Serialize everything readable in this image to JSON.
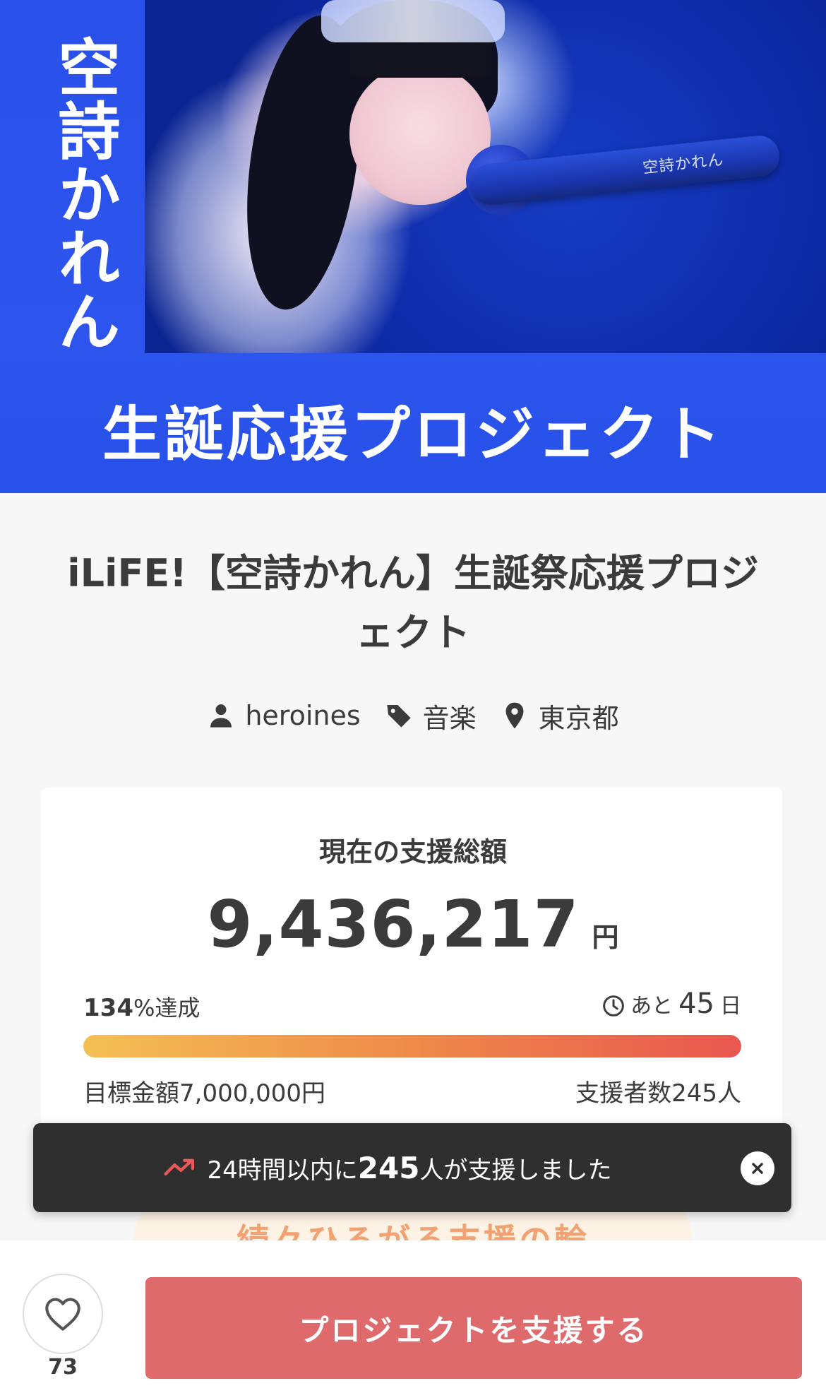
{
  "hero": {
    "vertical_title": "空詩かれん",
    "mic_label": "空詩かれん",
    "banner_text": "生誕応援プロジェクト"
  },
  "project": {
    "title": "iLiFE!【空詩かれん】生誕祭応援プロジェクト",
    "owner": "heroines",
    "category": "音楽",
    "location": "東京都"
  },
  "funding": {
    "label": "現在の支援総額",
    "amount": "9,436,217",
    "currency": "円",
    "percent_value": "134",
    "percent_suffix": "%達成",
    "progress_fraction": 1.0,
    "days_prefix": "あと",
    "days_value": "45",
    "days_suffix": "日",
    "goal": "目標金額7,000,000円",
    "backers": "支援者数245人"
  },
  "toast": {
    "prefix": "24時間以内に",
    "count": "245",
    "suffix": "人が支援しました"
  },
  "behind_pill": {
    "text": "続々ひろがる支援の輪"
  },
  "bottom": {
    "favorite_count": "73",
    "support_label": "プロジェクトを支援する"
  },
  "colors": {
    "hero_blue": "#2046e4",
    "progress_start": "#f4bf54",
    "progress_end": "#e8574f",
    "support_button": "#df6a6c",
    "toast_bg": "#2f2f30",
    "trend_icon": "#e85a5a"
  },
  "icons": {
    "owner": "person-icon",
    "category": "tag-icon",
    "location": "location-pin-icon",
    "days": "clock-icon",
    "trend": "trending-up-icon",
    "close": "close-icon",
    "favorite": "heart-icon"
  }
}
